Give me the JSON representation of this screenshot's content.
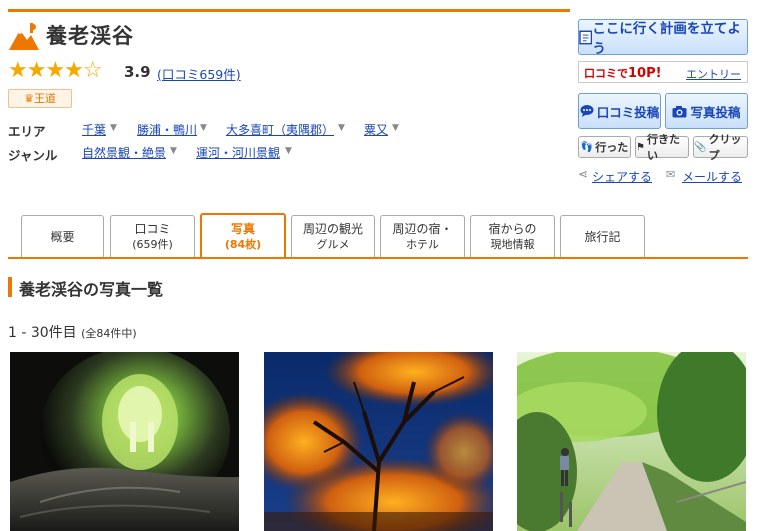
{
  "header": {
    "title": "養老渓谷",
    "stars": "★★★★☆",
    "rating": "3.9",
    "reviews_link": "(口コミ659件)",
    "badge": "王道"
  },
  "meta": {
    "area_label": "エリア",
    "area_links": [
      "千葉",
      "勝浦・鴨川",
      "大多喜町（夷隅郡）",
      "粟又"
    ],
    "genre_label": "ジャンル",
    "genre_links": [
      "自然景観・絶景",
      "運河・河川景観"
    ]
  },
  "actions": {
    "plan_button": "ここに行く計画を立てよう",
    "points_prefix": "口コミで",
    "points_value": "10P!",
    "entry_link": "エントリー",
    "review_button": "口コミ投稿",
    "photo_button": "写真投稿",
    "went_button": "行った",
    "want_button": "行きたい",
    "clip_button": "クリップ",
    "share_link": "シェアする",
    "mail_link": "メールする"
  },
  "tabs": [
    {
      "label": "概要",
      "sub": ""
    },
    {
      "label": "口コミ",
      "sub": "(659件)"
    },
    {
      "label": "写真",
      "sub": "(84枚)"
    },
    {
      "label": "周辺の観光",
      "sub": "グルメ"
    },
    {
      "label": "周辺の宿・",
      "sub": "ホテル"
    },
    {
      "label": "宿からの",
      "sub": "現地情報"
    },
    {
      "label": "旅行記",
      "sub": ""
    }
  ],
  "active_tab": "写真",
  "section": {
    "title": "養老渓谷の写真一覧",
    "count": "1 - 30件目",
    "count_total": "(全84件中)"
  },
  "colors": {
    "accent": "#ee7700",
    "link": "#1a47b8",
    "star": "#f5a800"
  },
  "photos": [
    {
      "name": "tunnel-photo"
    },
    {
      "name": "autumn-night-photo"
    },
    {
      "name": "green-path-photo"
    }
  ]
}
